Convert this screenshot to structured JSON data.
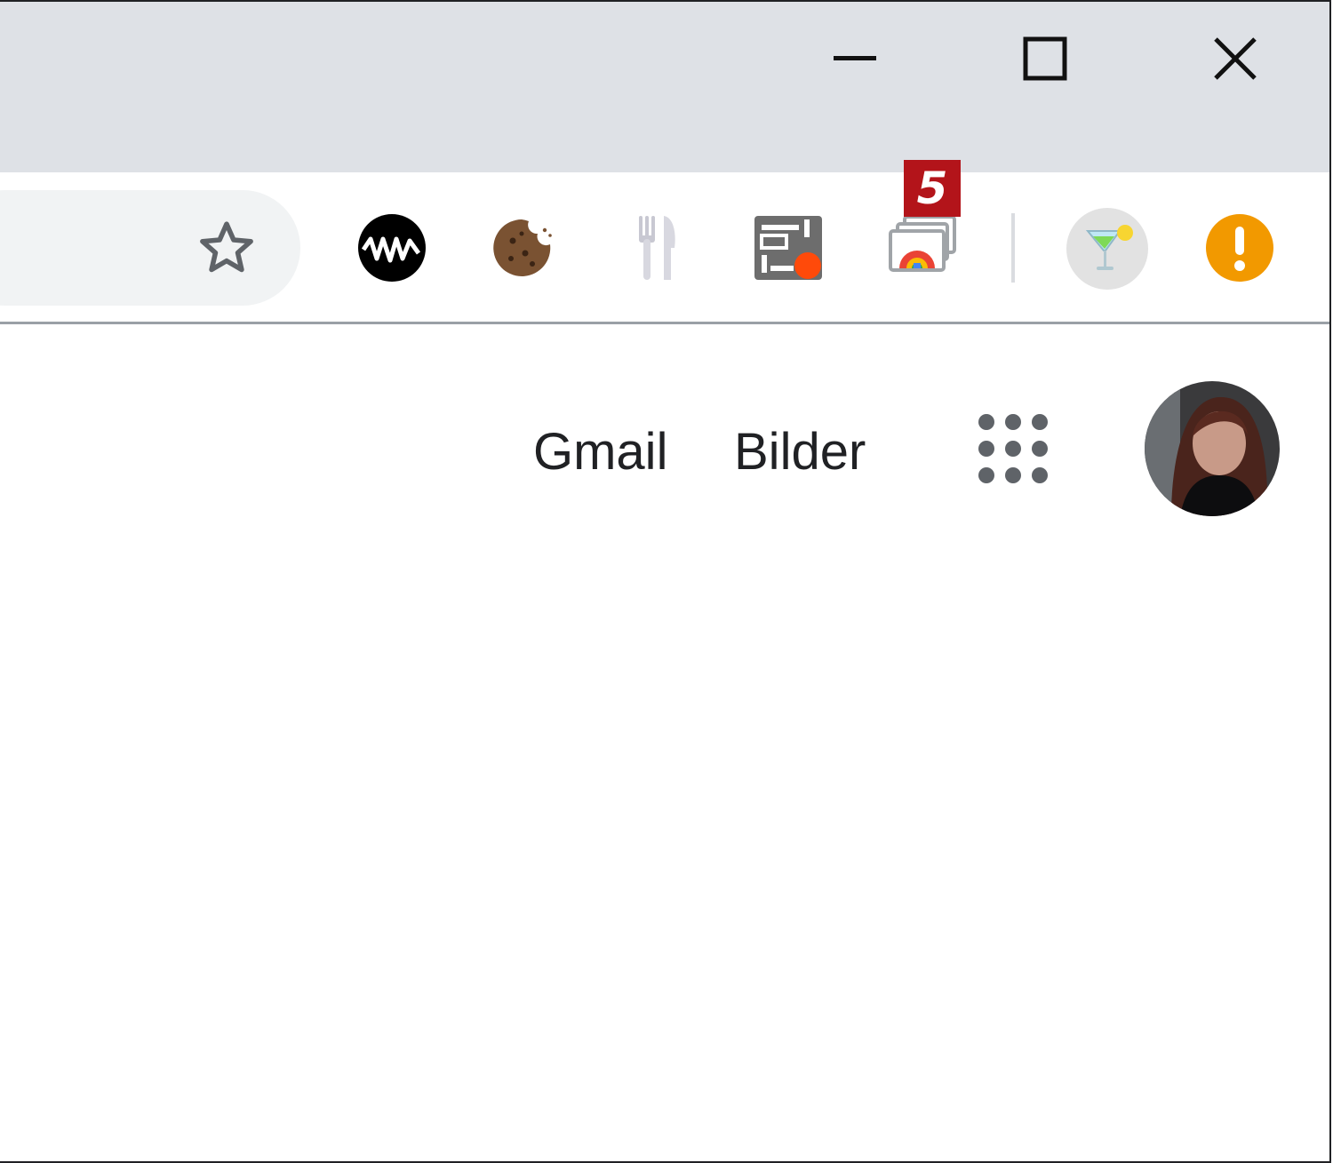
{
  "window_controls": {
    "minimize": "minimize-icon",
    "maximize": "maximize-icon",
    "close": "close-icon"
  },
  "toolbar": {
    "bookmark_icon": "star-outline-icon",
    "extensions": [
      {
        "name": "waveform-extension-icon",
        "color": "#000000"
      },
      {
        "name": "cookie-extension-icon",
        "color": "#6b4226"
      },
      {
        "name": "fork-knife-extension-icon",
        "color": "#cfcfd6"
      },
      {
        "name": "reader-alert-extension-icon",
        "color": "#6d6d6d"
      },
      {
        "name": "window-stack-extension-icon",
        "color": "#9aa0a6"
      },
      {
        "name": "cocktail-extension-icon",
        "color": "#e0e0e0"
      },
      {
        "name": "warning-extension-icon",
        "color": "#f29900"
      }
    ],
    "badge_count": "5",
    "badge_color": "#b3141a"
  },
  "header_links": {
    "gmail": "Gmail",
    "images": "Bilder"
  },
  "apps_icon": "apps-grid-icon",
  "avatar_icon": "profile-avatar"
}
